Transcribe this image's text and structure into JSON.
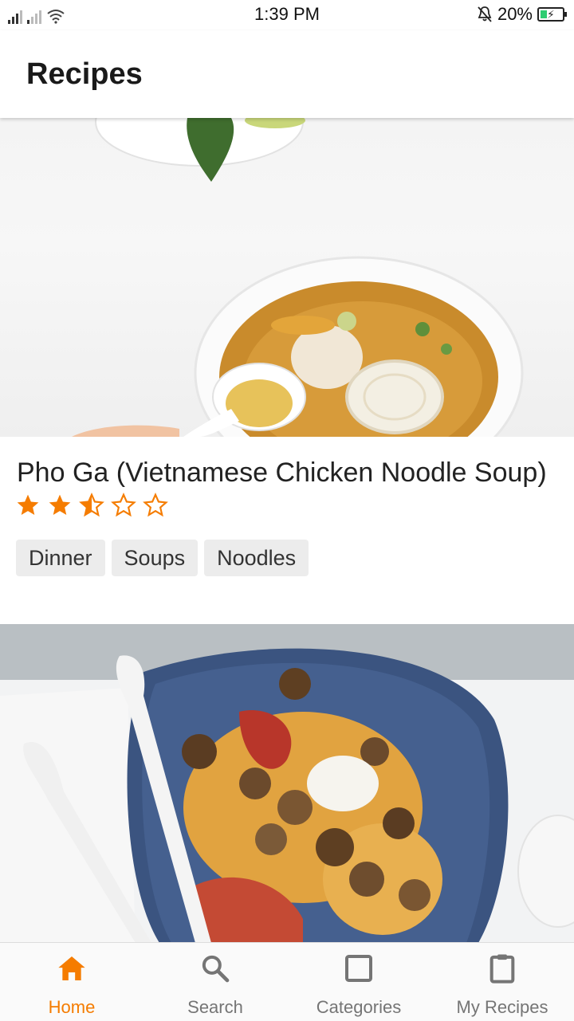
{
  "status_bar": {
    "time": "1:39 PM",
    "battery": "20%"
  },
  "app_bar": {
    "title": "Recipes"
  },
  "recipes": [
    {
      "title": "Pho Ga (Vietnamese Chicken Noodle Soup)",
      "rating": 2.5,
      "rating_max": 5,
      "tags": [
        "Dinner",
        "Soups",
        "Noodles"
      ]
    }
  ],
  "bottom_nav": {
    "items": [
      {
        "label": "Home",
        "icon": "home-icon",
        "active": true
      },
      {
        "label": "Search",
        "icon": "search-icon",
        "active": false
      },
      {
        "label": "Categories",
        "icon": "square-icon",
        "active": false
      },
      {
        "label": "My Recipes",
        "icon": "clipboard-icon",
        "active": false
      }
    ]
  },
  "colors": {
    "accent": "#f57c00",
    "star": "#f57c00",
    "inactive_nav": "#757575"
  }
}
